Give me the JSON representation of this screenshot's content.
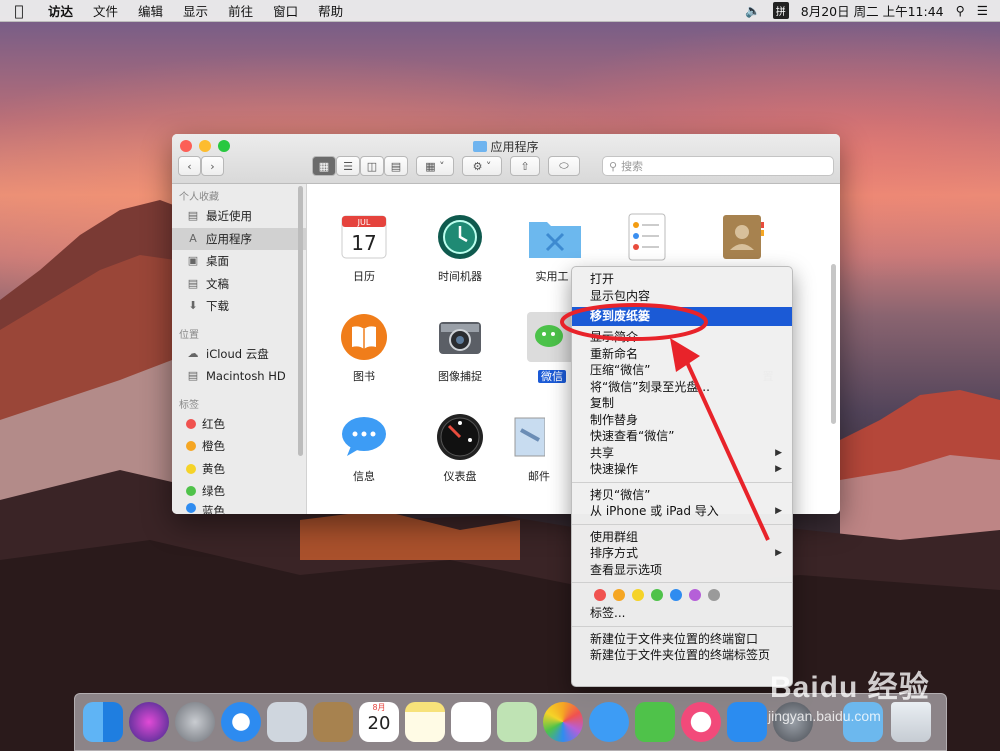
{
  "menubar": {
    "items": [
      "访达",
      "文件",
      "编辑",
      "显示",
      "前往",
      "窗口",
      "帮助"
    ],
    "ime": "拼",
    "clock": "8月20日 周二 上午11:44"
  },
  "finder": {
    "title": "应用程序",
    "search_placeholder": "搜索",
    "sidebar": {
      "favorites_header": "个人收藏",
      "favorites": [
        "最近使用",
        "应用程序",
        "桌面",
        "文稿",
        "下载"
      ],
      "locations_header": "位置",
      "locations": [
        "iCloud 云盘",
        "Macintosh HD"
      ],
      "tags_header": "标签",
      "tags": [
        {
          "label": "红色",
          "color": "#f0524f"
        },
        {
          "label": "橙色",
          "color": "#f5a623"
        },
        {
          "label": "黄色",
          "color": "#f5d328"
        },
        {
          "label": "绿色",
          "color": "#4fc24a"
        },
        {
          "label": "蓝色",
          "color": "#2f8cf0"
        }
      ]
    },
    "apps": [
      {
        "label": "日历",
        "icon": "calendar-icon"
      },
      {
        "label": "时间机器",
        "icon": "time-machine-icon"
      },
      {
        "label": "实用工",
        "icon": "utilities-folder-icon"
      },
      {
        "label": "",
        "icon": "reminders-icon"
      },
      {
        "label": "",
        "icon": "contacts-icon"
      },
      {
        "label": "图书",
        "icon": "books-icon"
      },
      {
        "label": "图像捕捉",
        "icon": "image-capture-icon"
      },
      {
        "label": "微信",
        "icon": "wechat-icon"
      },
      {
        "label": "置",
        "icon": "system-pref-icon"
      },
      {
        "label": "信息",
        "icon": "messages-icon"
      },
      {
        "label": "仪表盘",
        "icon": "dashboard-icon"
      },
      {
        "label": "邮件",
        "icon": "mail-icon"
      }
    ],
    "calendar_month": "JUL",
    "calendar_day": "17"
  },
  "context_menu": {
    "group1": [
      "打开",
      "显示包内容"
    ],
    "highlighted": "移到废纸篓",
    "group2": [
      "显示简介",
      "重新命名",
      "压缩“微信”",
      "将“微信”刻录至光盘...",
      "复制",
      "制作替身",
      "快速查看“微信”"
    ],
    "group2_sub": [
      "共享",
      "快速操作"
    ],
    "group3": [
      "拷贝“微信”"
    ],
    "group3_sub": "从 iPhone 或 iPad 导入",
    "group4": [
      "使用群组"
    ],
    "group4_sub": "排序方式",
    "group4_last": "查看显示选项",
    "tag_colors": [
      "#f0524f",
      "#f5a623",
      "#f5d328",
      "#4fc24a",
      "#2f8cf0",
      "#b55fd8",
      "#9a9a9a"
    ],
    "tags_label": "标签...",
    "group5": [
      "新建位于文件夹位置的终端窗口",
      "新建位于文件夹位置的终端标签页"
    ]
  },
  "dock": {
    "calendar_month": "8月",
    "calendar_day": "20"
  },
  "watermark": {
    "brand": "Baidu 经验",
    "url": "jingyan.baidu.com"
  }
}
